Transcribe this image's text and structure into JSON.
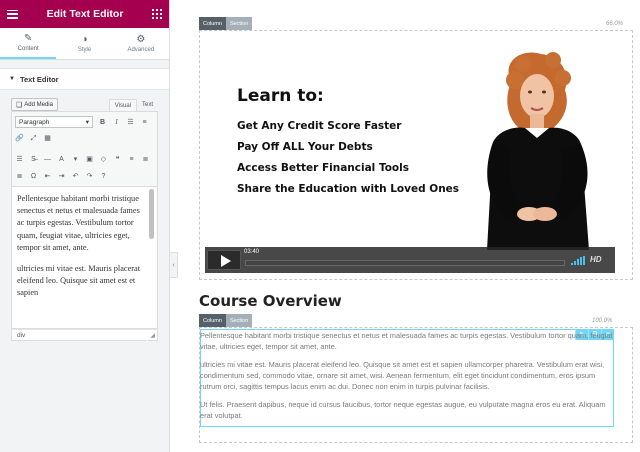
{
  "panel": {
    "title": "Edit Text Editor",
    "tabs": [
      {
        "label": "Content",
        "icon": "pencil-icon"
      },
      {
        "label": "Style",
        "icon": "contrast-icon"
      },
      {
        "label": "Advanced",
        "icon": "gear-icon"
      }
    ],
    "section_title": "Text Editor",
    "add_media_label": "Add Media",
    "mode_visual": "Visual",
    "mode_text": "Text",
    "format_select": "Paragraph",
    "editor_paragraphs": [
      "Pellentesque habitant morbi tristique senectus et netus et malesuada fames ac turpis egestas. Vestibulum tortor quam, feugiat vitae, ultricies eget, tempor sit amet, ante.",
      "ultricies mi vitae est. Mauris placerat eleifend leo. Quisque sit amet est et sapien"
    ],
    "status_path": "div"
  },
  "canvas": {
    "column_label": "Column",
    "section_label": "Section",
    "pct_top": "66.0%",
    "pct_inner": "100.0%",
    "video": {
      "heading": "Learn to:",
      "lines": [
        "Get Any Credit Score Faster",
        "Pay Off ALL Your Debts",
        "Access Better Financial Tools",
        "Share the Education with Loved Ones"
      ],
      "time": "03:40",
      "hd": "HD"
    },
    "course_heading": "Course Overview",
    "paragraphs": [
      "Pellentesque habitant morbi tristique senectus et netus et malesuada fames ac turpis egestas. Vestibulum tortor quam, feugiat vitae, ultricies eget, tempor sit amet, ante.",
      "ultricies mi vitae est. Mauris placerat eleifend leo. Quisque sit amet est et sapien ullamcorper pharetra. Vestibulum erat wisi, condimentum sed, commodo vitae, ornare sit amet, wisi. Aenean fermentum, elit eget tincidunt condimentum, eros ipsum rutrum orci, sagittis tempus lacus enim ac dui. Donec non enim in turpis pulvinar facilisis.",
      "Ut felis. Praesent dapibus, neque id cursus faucibus, tortor neque egestas augue, eu vulputate magna eros eu erat. Aliquam erat volutpat."
    ]
  },
  "colors": {
    "brand": "#a4004f",
    "accent": "#71d7f7",
    "column_tag": "#556068"
  }
}
